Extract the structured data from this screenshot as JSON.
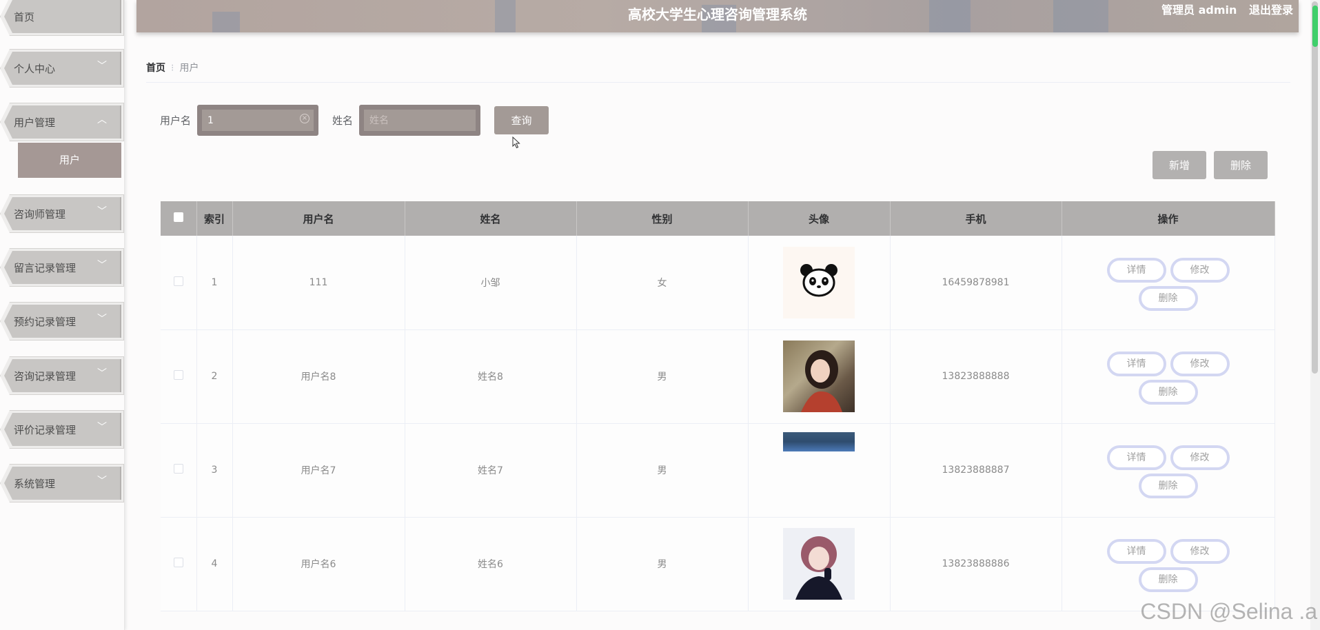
{
  "header": {
    "title": "高校大学生心理咨询管理系统",
    "user_label": "管理员 admin",
    "logout_label": "退出登录"
  },
  "sidebar": {
    "items": [
      {
        "label": "首页"
      },
      {
        "label": "个人中心"
      },
      {
        "label": "用户管理"
      },
      {
        "label": "咨询师管理"
      },
      {
        "label": "留言记录管理"
      },
      {
        "label": "预约记录管理"
      },
      {
        "label": "咨询记录管理"
      },
      {
        "label": "评价记录管理"
      },
      {
        "label": "系统管理"
      }
    ],
    "sub_item": "用户"
  },
  "breadcrumb": {
    "home": "首页",
    "current": "用户"
  },
  "search": {
    "username_label": "用户名",
    "username_value": "1",
    "name_label": "姓名",
    "name_placeholder": "姓名",
    "query_label": "查询"
  },
  "actions": {
    "add_label": "新增",
    "delete_label": "删除"
  },
  "table": {
    "headers": [
      "索引",
      "用户名",
      "姓名",
      "性别",
      "头像",
      "手机",
      "操作"
    ],
    "rows": [
      {
        "index": "1",
        "username": "111",
        "name": "小邹",
        "gender": "女",
        "avatar": "panda-avatar",
        "phone": "16459878981"
      },
      {
        "index": "2",
        "username": "用户名8",
        "name": "姓名8",
        "gender": "男",
        "avatar": "girl-photo-avatar",
        "phone": "13823888888"
      },
      {
        "index": "3",
        "username": "用户名7",
        "name": "姓名7",
        "gender": "男",
        "avatar": "partial-photo-avatar",
        "phone": "13823888887"
      },
      {
        "index": "4",
        "username": "用户名6",
        "name": "姓名6",
        "gender": "男",
        "avatar": "pink-hair-avatar",
        "phone": "13823888886"
      }
    ],
    "row_actions": {
      "detail": "详情",
      "edit": "修改",
      "delete": "删除"
    }
  },
  "watermark": "CSDN @Selina .a",
  "colors": {
    "accent": "#a39a96",
    "header": "#b2a49f",
    "op_border": "#d3d7f2"
  }
}
